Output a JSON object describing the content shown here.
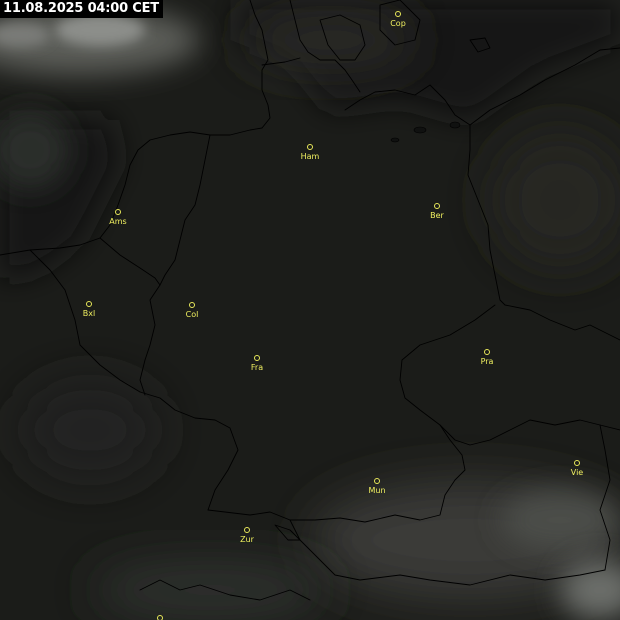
{
  "timestamp": "11.08.2025 04:00 CET",
  "colors": {
    "background": "#1b1c19",
    "cloud": "#9a9c98",
    "border": "#000000",
    "city_marker": "#e8e85a",
    "city_label": "#f0f060",
    "timestamp_bg": "#000000",
    "timestamp_text": "#ffffff"
  },
  "cities": [
    {
      "id": "copenhagen",
      "label": "Cop"
    },
    {
      "id": "hamburg",
      "label": "Ham"
    },
    {
      "id": "berlin",
      "label": "Ber"
    },
    {
      "id": "amsterdam",
      "label": "Ams"
    },
    {
      "id": "brussels",
      "label": "Bxl"
    },
    {
      "id": "cologne",
      "label": "Col"
    },
    {
      "id": "frankfurt",
      "label": "Fra"
    },
    {
      "id": "prague",
      "label": "Pra"
    },
    {
      "id": "munich",
      "label": "Mun"
    },
    {
      "id": "vienna",
      "label": "Vie"
    },
    {
      "id": "zurich",
      "label": "Zur"
    }
  ]
}
